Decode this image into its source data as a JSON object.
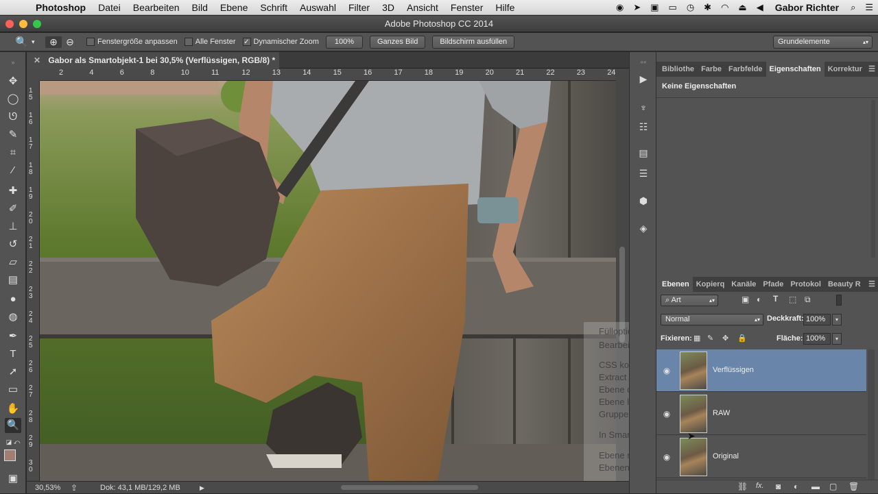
{
  "menubar": {
    "app": "Photoshop",
    "items": [
      "Datei",
      "Bearbeiten",
      "Bild",
      "Ebene",
      "Schrift",
      "Auswahl",
      "Filter",
      "3D",
      "Ansicht",
      "Fenster",
      "Hilfe"
    ],
    "user": "Gabor Richter"
  },
  "window": {
    "title": "Adobe Photoshop CC 2014"
  },
  "options": {
    "fit_window": "Fenstergröße anpassen",
    "all_windows": "Alle Fenster",
    "dynamic_zoom": "Dynamischer Zoom",
    "zoom_100": "100%",
    "whole_image": "Ganzes Bild",
    "fill_screen": "Bildschirm ausfüllen",
    "workspace": "Grundelemente"
  },
  "document": {
    "tab_title": "Gabor als Smartobjekt-1 bei 30,5% (Verflüssigen, RGB/8) *",
    "ruler_top": [
      "2",
      "4",
      "6",
      "8",
      "10",
      "11",
      "12",
      "13",
      "14",
      "15",
      "16",
      "17",
      "18",
      "19",
      "20",
      "21",
      "22",
      "23",
      "24"
    ],
    "ruler_left": [
      "1 5",
      "1 6",
      "1 7",
      "1 8",
      "1 9",
      "2 0",
      "2 1",
      "2 2",
      "2 3",
      "2 4",
      "2 5",
      "2 6",
      "2 7",
      "2 8",
      "2 9",
      "3 0"
    ]
  },
  "status": {
    "zoom": "30,53%",
    "doc": "Dok: 43,1 MB/129,2 MB"
  },
  "properties_panel": {
    "tabs": [
      "Bibliothe",
      "Farbe",
      "Farbfelde",
      "Eigenschaften",
      "Korrektur"
    ],
    "active_tab": "Eigenschaften",
    "empty_text": "Keine Eigenschaften"
  },
  "layers_panel": {
    "tabs": [
      "Ebenen",
      "Kopierq",
      "Kanäle",
      "Pfade",
      "Protokol",
      "Beauty R"
    ],
    "filter_kind": "Art",
    "blend_mode": "Normal",
    "opacity_label": "Deckkraft:",
    "opacity": "100%",
    "lock_label": "Fixieren:",
    "fill_label": "Fläche:",
    "fill": "100%",
    "layers": [
      {
        "name": "Verflüssigen",
        "selected": true
      },
      {
        "name": "RAW",
        "selected": false
      },
      {
        "name": "Original",
        "selected": false
      }
    ]
  },
  "context_menu": {
    "items": [
      "Fülloptionen...",
      "Bearbeiten ...",
      "CSS kopieren",
      "Extract Assets...",
      "Ebene duplizieren...",
      "Ebene löschen",
      "Gruppe aus Ebenen",
      "In Smartobjekt konvertieren",
      "Ebene rastern",
      "Ebenen ..."
    ]
  }
}
